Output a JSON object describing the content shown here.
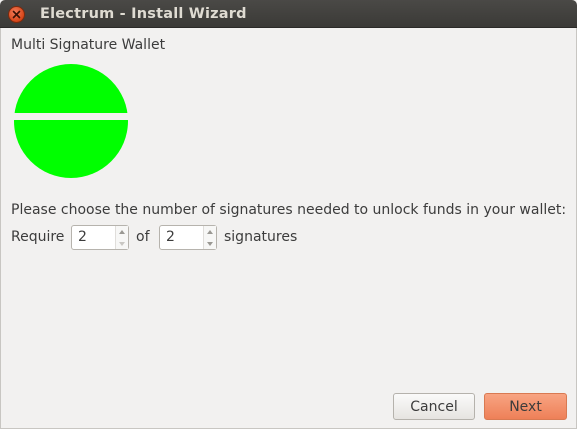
{
  "window": {
    "title": "Electrum  -  Install Wizard"
  },
  "page": {
    "heading": "Multi Signature Wallet",
    "prompt": "Please choose the number of signatures needed to unlock funds in your wallet:",
    "require_label": "Require",
    "of_label": "of",
    "signatures_label": "signatures"
  },
  "spinners": {
    "required": {
      "value": "2"
    },
    "total": {
      "value": "2"
    }
  },
  "buttons": {
    "cancel": "Cancel",
    "next": "Next"
  },
  "colors": {
    "graphic_green": "#00ff00",
    "next_button": "#ee8058",
    "close_button": "#d64518"
  }
}
